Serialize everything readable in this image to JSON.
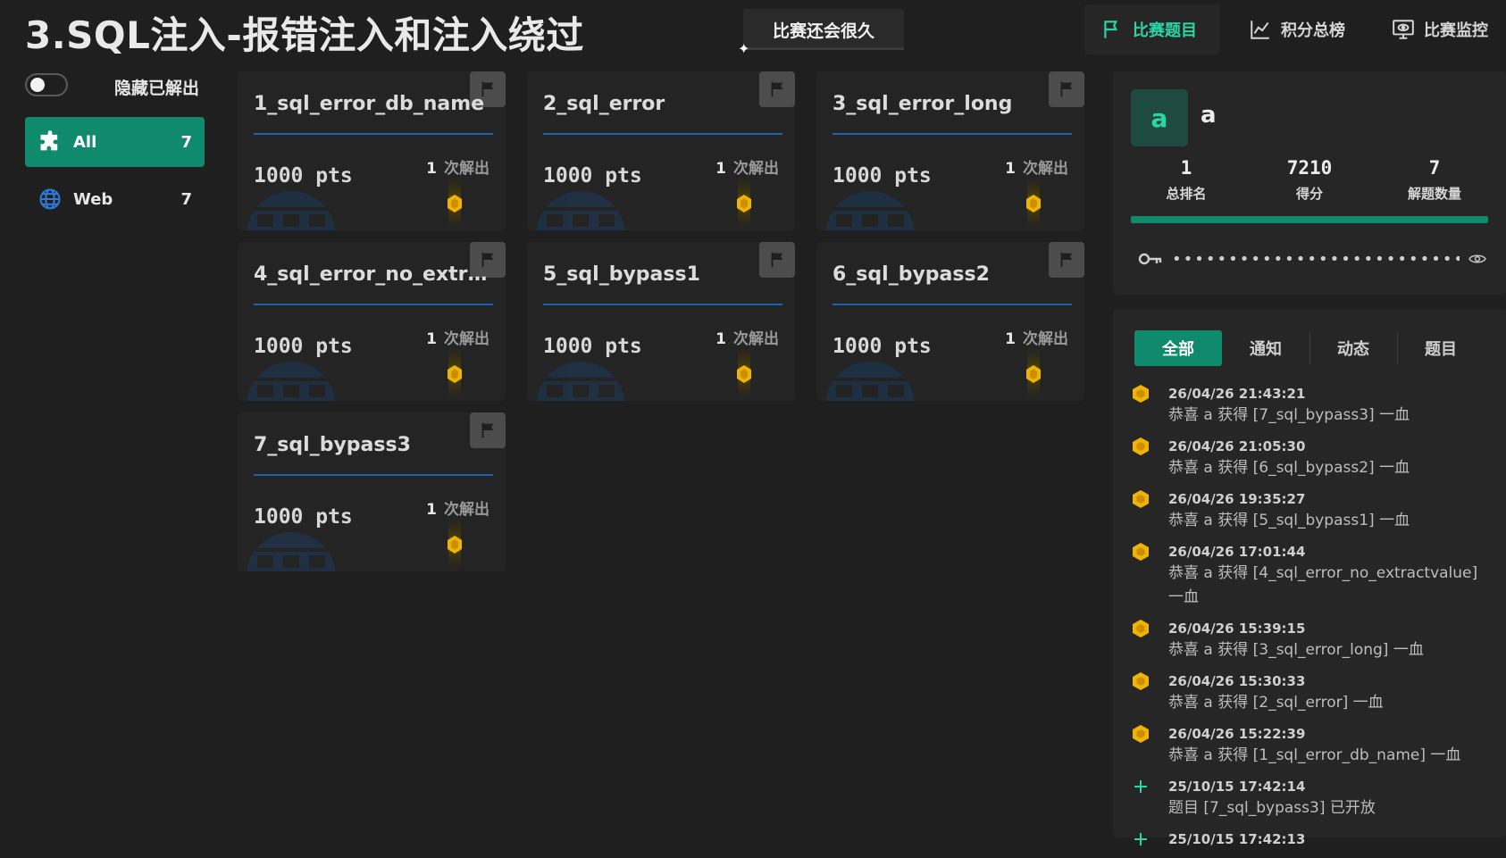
{
  "header": {
    "title": "3.SQL注入-报错注入和注入绕过",
    "countdown": "比赛还会很久",
    "nav": {
      "challenges": "比赛题目",
      "scoreboard": "积分总榜",
      "monitor": "比赛监控"
    }
  },
  "sidebar": {
    "toggle_label": "隐藏已解出",
    "categories": [
      {
        "label": "All",
        "count": "7",
        "icon": "puzzle-icon"
      },
      {
        "label": "Web",
        "count": "7",
        "icon": "globe-icon"
      }
    ]
  },
  "challenges": [
    {
      "name": "1_sql_error_db_name",
      "pts": "1000 pts",
      "solves": "1",
      "solves_unit": "次解出"
    },
    {
      "name": "2_sql_error",
      "pts": "1000 pts",
      "solves": "1",
      "solves_unit": "次解出"
    },
    {
      "name": "3_sql_error_long",
      "pts": "1000 pts",
      "solves": "1",
      "solves_unit": "次解出"
    },
    {
      "name": "4_sql_error_no_extract...",
      "pts": "1000 pts",
      "solves": "1",
      "solves_unit": "次解出"
    },
    {
      "name": "5_sql_bypass1",
      "pts": "1000 pts",
      "solves": "1",
      "solves_unit": "次解出"
    },
    {
      "name": "6_sql_bypass2",
      "pts": "1000 pts",
      "solves": "1",
      "solves_unit": "次解出"
    },
    {
      "name": "7_sql_bypass3",
      "pts": "1000 pts",
      "solves": "1",
      "solves_unit": "次解出"
    }
  ],
  "profile": {
    "avatar_letter": "a",
    "username": "a",
    "rank": "1",
    "rank_label": "总排名",
    "score": "7210",
    "score_label": "得分",
    "solved": "7",
    "solved_label": "解题数量",
    "progress_fraction": 1.0,
    "token_mask": "••••••••••••••••••••••••••••••"
  },
  "feed": {
    "tabs": [
      "全部",
      "通知",
      "动态",
      "题目"
    ],
    "active_tab": 0,
    "events": [
      {
        "type": "blood",
        "time": "26/04/26 21:43:21",
        "text": "恭喜 a 获得 [7_sql_bypass3] 一血"
      },
      {
        "type": "blood",
        "time": "26/04/26 21:05:30",
        "text": "恭喜 a 获得 [6_sql_bypass2] 一血"
      },
      {
        "type": "blood",
        "time": "26/04/26 19:35:27",
        "text": "恭喜 a 获得 [5_sql_bypass1] 一血"
      },
      {
        "type": "blood",
        "time": "26/04/26 17:01:44",
        "text": "恭喜 a 获得 [4_sql_error_no_extractvalue] 一血"
      },
      {
        "type": "blood",
        "time": "26/04/26 15:39:15",
        "text": "恭喜 a 获得 [3_sql_error_long] 一血"
      },
      {
        "type": "blood",
        "time": "26/04/26 15:30:33",
        "text": "恭喜 a 获得 [2_sql_error] 一血"
      },
      {
        "type": "blood",
        "time": "26/04/26 15:22:39",
        "text": "恭喜 a 获得 [1_sql_error_db_name] 一血"
      },
      {
        "type": "new",
        "time": "25/10/15 17:42:14",
        "text": "题目 [7_sql_bypass3] 已开放"
      },
      {
        "type": "new",
        "time": "25/10/15 17:42:13",
        "text": ""
      }
    ]
  },
  "colors": {
    "accent": "#0f8a6c",
    "accent_text": "#2ad6a8",
    "card_bg": "#242424",
    "rule_blue": "#1f5fb0",
    "medal_gold": "#f0b400"
  }
}
